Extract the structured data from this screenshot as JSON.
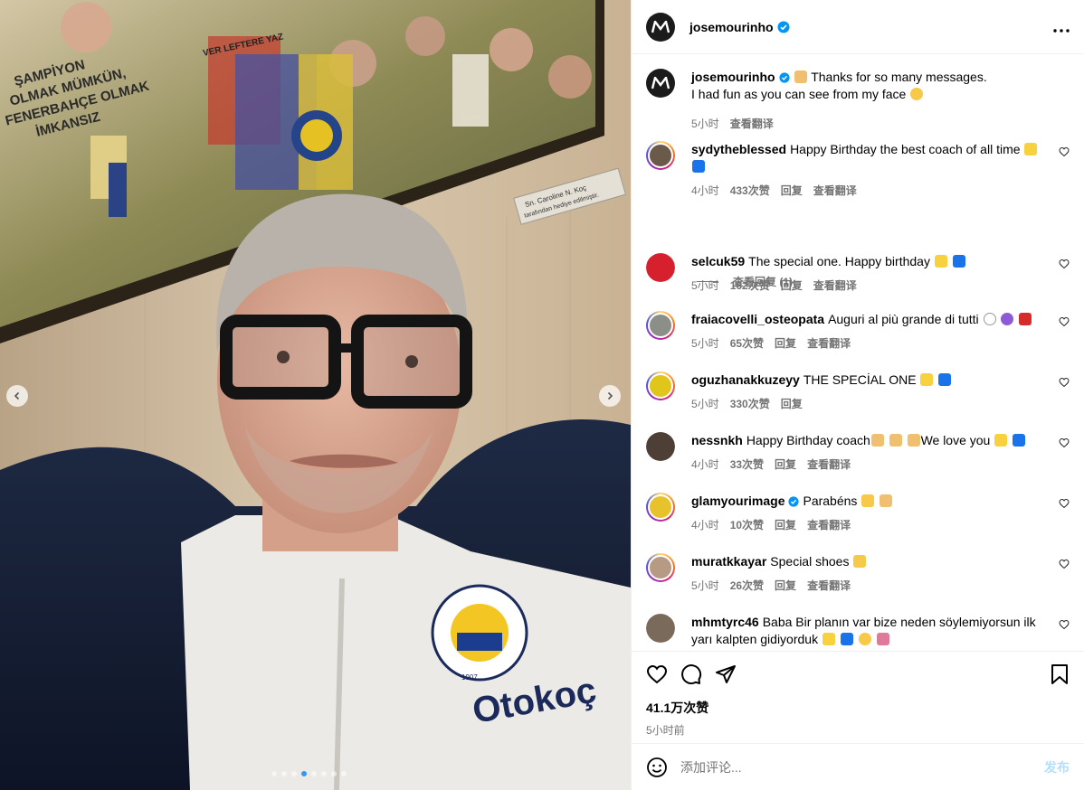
{
  "post": {
    "author": "josemourinho",
    "caption_text": "Thanks for so many messages.",
    "caption_line2": "I had fun as you can see from my face",
    "caption_time": "5小时",
    "caption_translate": "查看翻译",
    "likes": "41.1万次赞",
    "posted_ago": "5小时前",
    "carousel_total": 8,
    "carousel_active": 4
  },
  "photo": {
    "sign_line1": "Sn. Caroline N. Koç",
    "sign_line2": "tarafından hediye edilmiştir.",
    "wall_text1": "ŞAMPİYON",
    "wall_text2": "OLMAK MÜMKÜN,",
    "wall_text3": "FENERBAHÇE OLMAK",
    "wall_text4": "İMKANSIZ",
    "banner_text": "VER LEFTERE YAZ",
    "jacket_brand": "Otokoç",
    "jacket_logo_top": "FENERBAHÇE SPOR KULÜBÜ",
    "jacket_logo_year": "1907"
  },
  "comments": [
    {
      "user": "sydytheblessed",
      "text": "Happy Birthday the best coach of all time",
      "time": "4小时",
      "likes": "433次赞",
      "reply": "回复",
      "translate": "查看翻译",
      "view_replies": "查看回复 (1)"
    },
    {
      "user": "selcuk59",
      "text": "The special one. Happy birthday",
      "time": "5小时",
      "likes": "162次赞",
      "reply": "回复",
      "translate": "查看翻译"
    },
    {
      "user": "fraiacovelli_osteopata",
      "text": "Auguri al più grande di tutti",
      "time": "5小时",
      "likes": "65次赞",
      "reply": "回复",
      "translate": "查看翻译"
    },
    {
      "user": "oguzhanakkuzeyy",
      "text": "THE SPECİAL ONE",
      "time": "5小时",
      "likes": "330次赞",
      "reply": "回复"
    },
    {
      "user": "nessnkh",
      "text": "Happy Birthday coach",
      "text2": "We love you",
      "time": "4小时",
      "likes": "33次赞",
      "reply": "回复",
      "translate": "查看翻译"
    },
    {
      "user": "glamyourimage",
      "text": "Parabéns",
      "time": "4小时",
      "likes": "10次赞",
      "reply": "回复",
      "translate": "查看翻译"
    },
    {
      "user": "muratkkayar",
      "text": "Special shoes",
      "time": "5小时",
      "likes": "26次赞",
      "reply": "回复",
      "translate": "查看翻译"
    },
    {
      "user": "mhmtyrc46",
      "text": "Baba Bir planın var bize neden söylemiyorsun ilk",
      "text_line2": "yarı kalpten gidiyorduk"
    }
  ],
  "composer": {
    "placeholder": "添加评论...",
    "post_label": "发布"
  },
  "colors": {
    "verified_blue": "#0095f6",
    "muted_text": "#737373",
    "post_button_disabled": "#b2dffc",
    "carousel_active_dot": "#3797f0"
  },
  "icons": {
    "header": [
      "verified-icon",
      "more-options-icon"
    ],
    "actions": [
      "heart-icon",
      "comment-icon",
      "share-icon",
      "bookmark-icon"
    ],
    "composer": "emoji-icon",
    "carousel": [
      "chevron-left-icon",
      "chevron-right-icon"
    ]
  }
}
